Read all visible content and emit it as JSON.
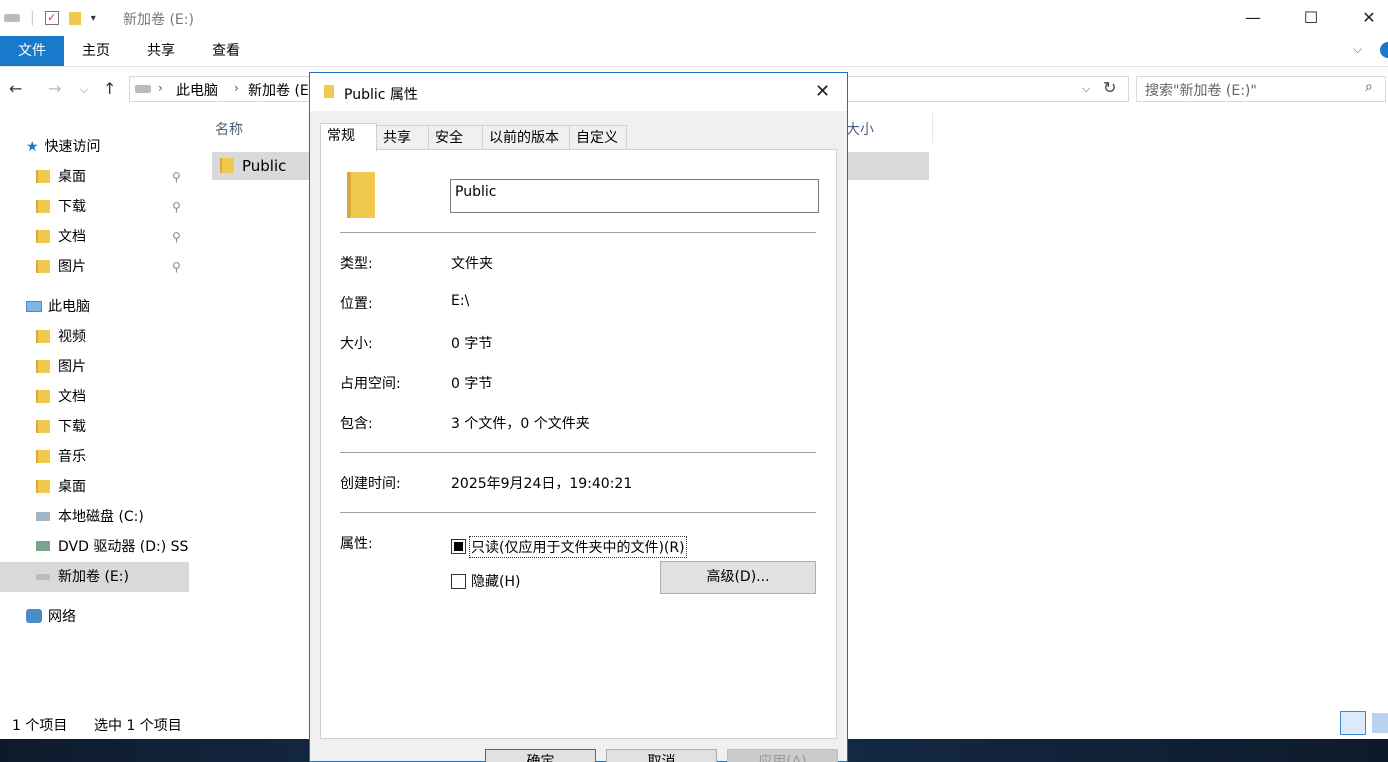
{
  "window": {
    "title": "新加卷 (E:)",
    "ribbon_tabs": [
      "文件",
      "主页",
      "共享",
      "查看"
    ]
  },
  "address": {
    "crumbs": [
      "此电脑",
      "新加卷 (E:)"
    ],
    "search_placeholder": "搜索\"新加卷 (E:)\""
  },
  "sidebar": {
    "quick_access": "快速访问",
    "quick_items": [
      "桌面",
      "下载",
      "文档",
      "图片"
    ],
    "this_pc": "此电脑",
    "pc_items": [
      "视频",
      "图片",
      "文档",
      "下载",
      "音乐",
      "桌面",
      "本地磁盘 (C:)",
      "DVD 驱动器 (D:) SS",
      "新加卷 (E:)"
    ],
    "network": "网络"
  },
  "file_list": {
    "columns": {
      "name": "名称",
      "size": "大小"
    },
    "rows": [
      {
        "name": "Public"
      }
    ]
  },
  "status": {
    "count": "1 个项目",
    "selected": "选中 1 个项目"
  },
  "dialog": {
    "title": "Public 属性",
    "tabs": [
      "常规",
      "共享",
      "安全",
      "以前的版本",
      "自定义"
    ],
    "name_value": "Public",
    "fields": {
      "type_label": "类型:",
      "type_value": "文件夹",
      "location_label": "位置:",
      "location_value": "E:\\",
      "size_label": "大小:",
      "size_value": "0 字节",
      "disk_label": "占用空间:",
      "disk_value": "0 字节",
      "contains_label": "包含:",
      "contains_value": "3 个文件，0 个文件夹",
      "created_label": "创建时间:",
      "created_value": "2025年9月24日，19:40:21",
      "attr_label": "属性:"
    },
    "readonly_label": "只读(仅应用于文件夹中的文件)(R)",
    "hidden_label": "隐藏(H)",
    "advanced_label": "高级(D)...",
    "buttons": {
      "ok": "确定",
      "cancel": "取消",
      "apply": "应用(A)"
    }
  },
  "colors": {
    "accent": "#1979ca",
    "folder": "#f1c951",
    "selection": "#d9d9d9"
  }
}
